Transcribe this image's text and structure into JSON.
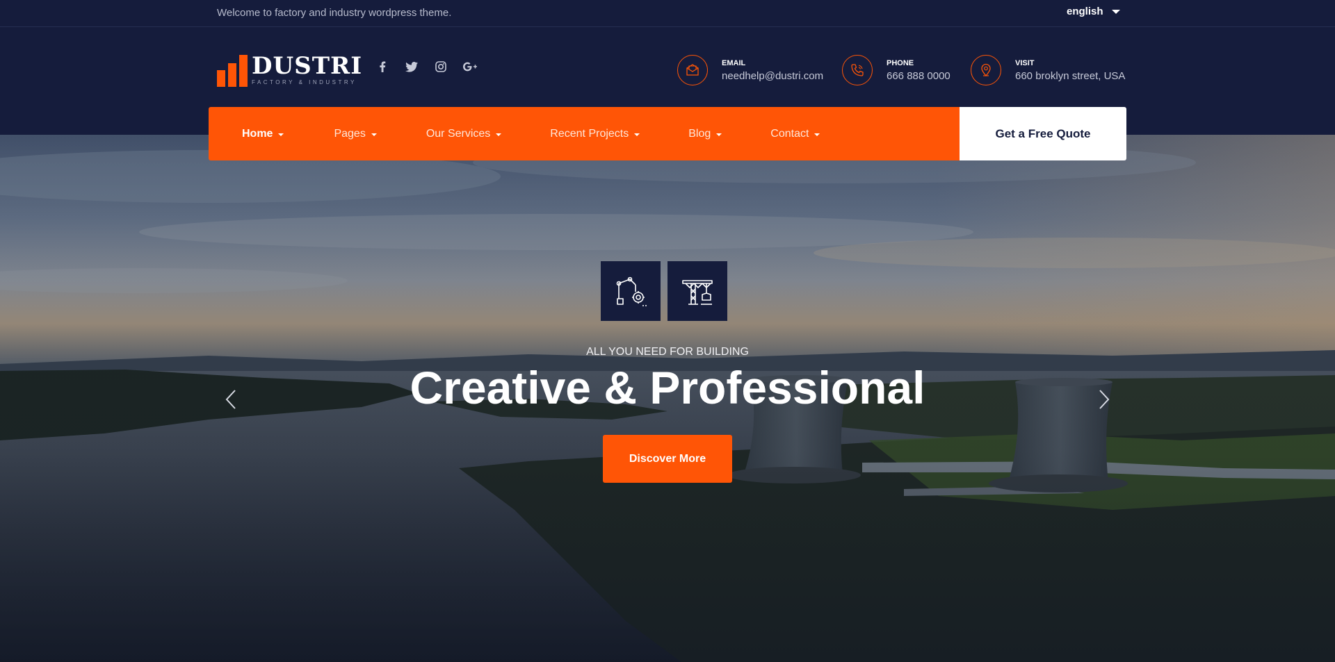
{
  "topbar": {
    "welcome": "Welcome to factory and industry wordpress theme.",
    "language": "english"
  },
  "brand": {
    "name": "DUSTRI",
    "tagline": "FACTORY & INDUSTRY",
    "accent": "#ff5506",
    "navy": "#151c3c"
  },
  "socials": [
    "facebook-icon",
    "twitter-icon",
    "instagram-icon",
    "google-plus-icon"
  ],
  "contacts": [
    {
      "label": "EMAIL",
      "value": "needhelp@dustri.com",
      "icon": "envelope-icon"
    },
    {
      "label": "PHONE",
      "value": "666 888 0000",
      "icon": "phone-icon"
    },
    {
      "label": "VISIT",
      "value": "660 broklyn street, USA",
      "icon": "map-pin-icon"
    }
  ],
  "nav": {
    "items": [
      {
        "label": "Home",
        "active": true
      },
      {
        "label": "Pages"
      },
      {
        "label": "Our Services"
      },
      {
        "label": "Recent Projects"
      },
      {
        "label": "Blog"
      },
      {
        "label": "Contact"
      }
    ],
    "cta": "Get a Free Quote"
  },
  "hero": {
    "icons": [
      "robotic-arm-icon",
      "crane-icon"
    ],
    "eyebrow": "ALL YOU NEED FOR BUILDING",
    "title": "Creative & Professional",
    "button": "Discover More",
    "prev_icon": "chevron-left-icon",
    "next_icon": "chevron-right-icon"
  }
}
